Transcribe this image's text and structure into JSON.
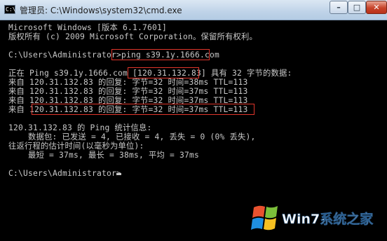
{
  "window": {
    "title": "管理员: C:\\Windows\\system32\\cmd.exe",
    "icon_text": "C:\\",
    "controls": {
      "minimize": "–",
      "maximize": "□",
      "close": "✕"
    }
  },
  "console": {
    "lines": [
      "Microsoft Windows [版本 6.1.7601]",
      "版权所有 (c) 2009 Microsoft Corporation。保留所有权利。",
      "",
      "C:\\Users\\Administrator>ping s39.1y.1666.com",
      "",
      "正在 Ping s39.1y.1666.com [120.31.132.83] 具有 32 字节的数据:",
      "来自 120.31.132.83 的回复: 字节=32 时间=38ms TTL=113",
      "来自 120.31.132.83 的回复: 字节=32 时间=37ms TTL=113",
      "来自 120.31.132.83 的回复: 字节=32 时间=37ms TTL=113",
      "来自 120.31.132.83 的回复: 字节=32 时间=37ms TTL=113",
      "",
      "120.31.132.83 的 Ping 统计信息:",
      "    数据包: 已发送 = 4, 已接收 = 4, 丢失 = 0 (0% 丢失),",
      "往返行程的估计时间(以毫秒为单位):",
      "    最短 = 37ms, 最长 = 38ms, 平均 = 37ms",
      "",
      "C:\\Users\\Administrator>"
    ]
  },
  "watermark": {
    "brand": "Win7系统之家",
    "icon": "windows-logo-icon"
  },
  "colors": {
    "console_bg": "#000000",
    "console_text": "#c8c8c8",
    "highlight": "#e0352b"
  }
}
